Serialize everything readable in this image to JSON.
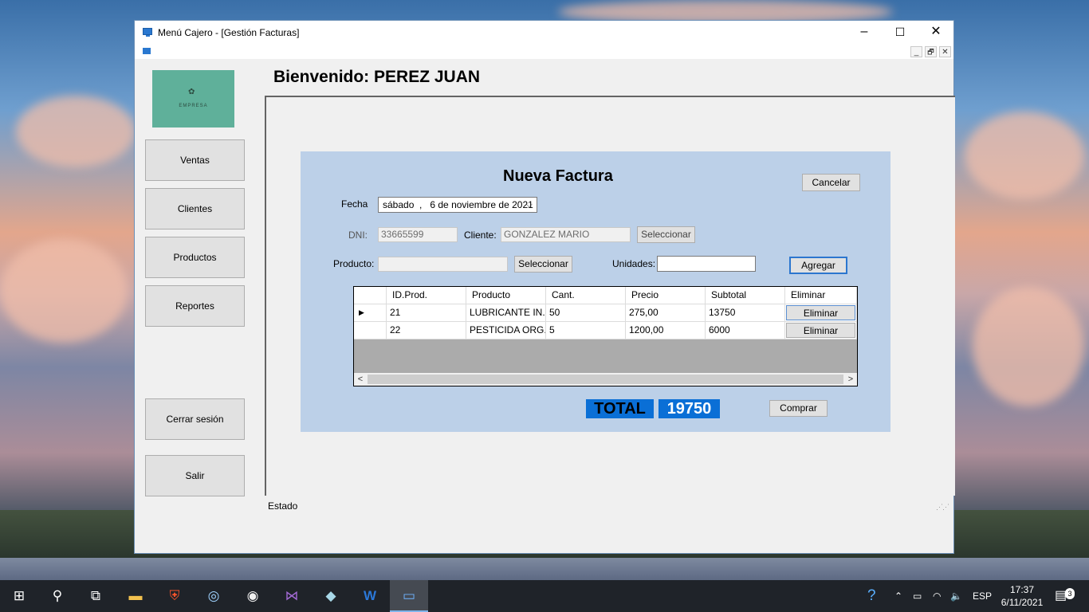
{
  "window": {
    "title": "Menú Cajero - [Gestión Facturas]",
    "minimize_glyph": "–",
    "maximize_glyph": "☐",
    "close_glyph": "✕",
    "mdi_min_glyph": "_",
    "mdi_restore_glyph": "🗗",
    "mdi_close_glyph": "✕"
  },
  "sidebar": {
    "logo_text": "EMPRESA",
    "items": [
      {
        "label": "Ventas"
      },
      {
        "label": "Clientes"
      },
      {
        "label": "Productos"
      },
      {
        "label": "Reportes"
      }
    ],
    "logout_label": "Cerrar sesión",
    "exit_label": "Salir"
  },
  "header": {
    "welcome": "Bienvenido: PEREZ JUAN"
  },
  "form": {
    "title": "Nueva Factura",
    "cancel_label": "Cancelar",
    "fecha_label": "Fecha",
    "fecha_value": "sábado  ,   6 de noviembre de 2021",
    "dni_label": "DNI:",
    "dni_value": "33665599",
    "cliente_label": "Cliente:",
    "cliente_value": "GONZALEZ MARIO",
    "select_client_label": "Seleccionar",
    "producto_label": "Producto:",
    "producto_value": "",
    "select_product_label": "Seleccionar",
    "unidades_label": "Unidades:",
    "unidades_value": "",
    "add_label": "Agregar",
    "total_label": "TOTAL",
    "total_value": "19750",
    "buy_label": "Comprar"
  },
  "grid": {
    "columns": [
      "ID.Prod.",
      "Producto",
      "Cant.",
      "Precio",
      "Subtotal",
      "Eliminar"
    ],
    "rows": [
      {
        "id": "21",
        "producto": "LUBRICANTE IN...",
        "cant": "50",
        "precio": "275,00",
        "subtotal": "13750",
        "eliminar": "Eliminar",
        "selected": true
      },
      {
        "id": "22",
        "producto": "PESTICIDA ORG...",
        "cant": "5",
        "precio": "1200,00",
        "subtotal": "6000",
        "eliminar": "Eliminar",
        "selected": false
      }
    ],
    "row_indicator": "▶",
    "scroll_left": "<",
    "scroll_right": ">"
  },
  "statusbar": {
    "text": "Estado"
  },
  "taskbar": {
    "language": "ESP",
    "time": "17:37",
    "date": "6/11/2021",
    "notifications": "3"
  }
}
